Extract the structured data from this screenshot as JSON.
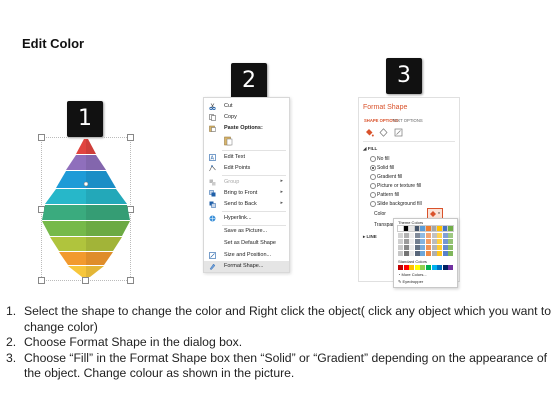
{
  "title": "Edit Color",
  "steps": {
    "one": "1",
    "two": "2",
    "three": "3"
  },
  "pyramid": {
    "colors": [
      "#e0443f",
      "#8f6fbc",
      "#1e9bd7",
      "#27b7c9",
      "#3aab7e",
      "#76b94a",
      "#b0c43d",
      "#f29a2e",
      "#f7c63b"
    ]
  },
  "context_menu": {
    "items": [
      {
        "label": "Cut",
        "icon": "scissors-icon"
      },
      {
        "label": "Copy",
        "icon": "copy-icon"
      },
      {
        "label": "Paste Options:",
        "icon": "paste-icon"
      },
      {
        "label": "Edit Text",
        "icon": "edit-text-icon"
      },
      {
        "label": "Edit Points",
        "icon": "edit-points-icon"
      },
      {
        "label": "Group",
        "icon": "group-icon"
      },
      {
        "label": "Bring to Front",
        "icon": "bring-front-icon"
      },
      {
        "label": "Send to Back",
        "icon": "send-back-icon"
      },
      {
        "label": "Hyperlink...",
        "icon": "hyperlink-icon"
      },
      {
        "label": "Save as Picture...",
        "icon": ""
      },
      {
        "label": "Set as Default Shape",
        "icon": ""
      },
      {
        "label": "Size and Position...",
        "icon": "size-icon"
      },
      {
        "label": "Format Shape...",
        "icon": "format-icon"
      }
    ]
  },
  "format_panel": {
    "title": "Format Shape",
    "tabs": [
      "SHAPE OPTIONS",
      "TEXT OPTIONS"
    ],
    "fill_section": "FILL",
    "fill_options": [
      "No fill",
      "Solid fill",
      "Gradient fill",
      "Picture or texture fill",
      "Pattern fill",
      "Slide background fill"
    ],
    "color_label": "Color",
    "transparency_label": "Transpar",
    "line_section": "LINE",
    "palette": {
      "theme_label": "Theme Colors",
      "standard_label": "Standard Colors",
      "more_label": "More Colors...",
      "eyedropper_label": "Eyedropper",
      "accent": "#d9522b"
    }
  },
  "instructions": [
    {
      "num": "1.",
      "text": "Select the shape to change the color and Right click the object( click any object which you want to change color)"
    },
    {
      "num": "2.",
      "text": "Choose Format Shape in the dialog box."
    },
    {
      "num": "3.",
      "text": "Choose “Fill” in the Format Shape box then “Solid” or “Gradient” depending on the appearance of the object. Change colour as shown in the picture."
    }
  ]
}
